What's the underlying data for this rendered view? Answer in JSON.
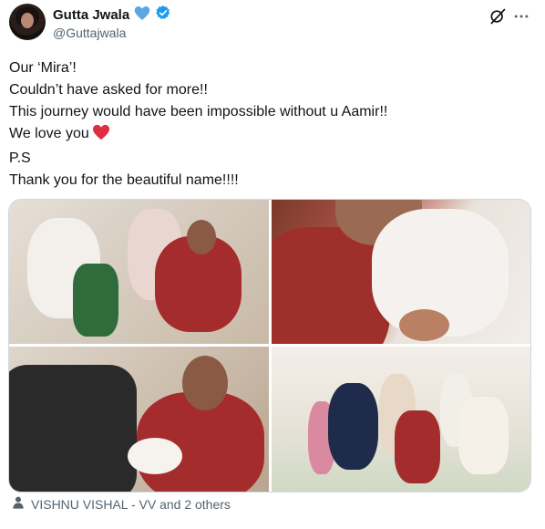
{
  "author": {
    "display_name": "Gutta Jwala",
    "handle": "@Guttajwala"
  },
  "tweet": {
    "lines": [
      "Our ‘Mira’!",
      "Couldn’t have asked for more!!",
      "This journey would have been impossible without u Aamir!!",
      "We love you",
      "P.S",
      "Thank you for the beautiful name!!!!"
    ]
  },
  "media": {
    "count": 4
  },
  "footer": {
    "tagged_text": "VISHNU VISHAL - VV and 2 others"
  },
  "colors": {
    "verified_blue": "#1d9bf0",
    "heart_red": "#e0245e",
    "heart_emoji_red": "#dd2e44",
    "secondary_text": "#536471"
  },
  "icons": {
    "verified": "verified-badge-icon",
    "heart_badge": "blue-heart-icon",
    "grok": "grok-icon",
    "more": "more-icon",
    "person": "person-icon",
    "red_heart": "red-heart-emoji"
  }
}
